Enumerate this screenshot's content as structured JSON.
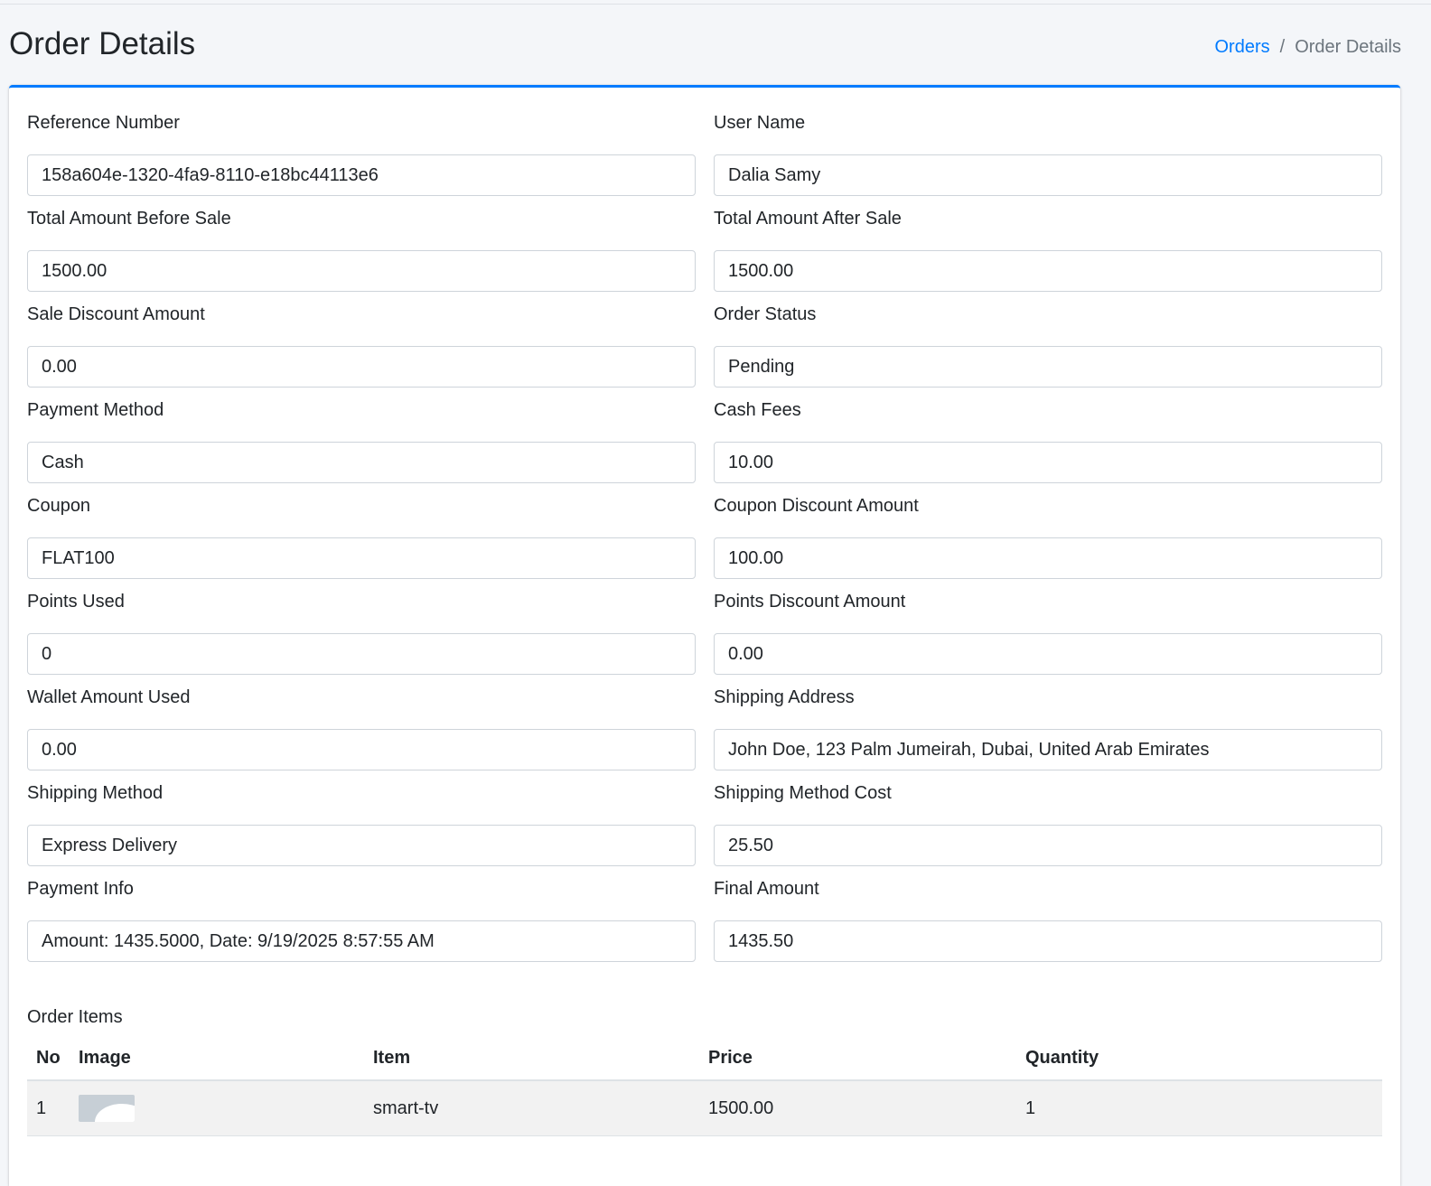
{
  "page": {
    "title": "Order Details"
  },
  "breadcrumb": {
    "parent": "Orders",
    "separator": "/",
    "current": "Order Details"
  },
  "fields": {
    "reference_number": {
      "label": "Reference Number",
      "value": "158a604e-1320-4fa9-8110-e18bc44113e6"
    },
    "user_name": {
      "label": "User Name",
      "value": "Dalia Samy"
    },
    "total_before_sale": {
      "label": "Total Amount Before Sale",
      "value": "1500.00"
    },
    "total_after_sale": {
      "label": "Total Amount After Sale",
      "value": "1500.00"
    },
    "sale_discount": {
      "label": "Sale Discount Amount",
      "value": "0.00"
    },
    "order_status": {
      "label": "Order Status",
      "value": "Pending"
    },
    "payment_method": {
      "label": "Payment Method",
      "value": "Cash"
    },
    "cash_fees": {
      "label": "Cash Fees",
      "value": "10.00"
    },
    "coupon": {
      "label": "Coupon",
      "value": "FLAT100"
    },
    "coupon_discount": {
      "label": "Coupon Discount Amount",
      "value": "100.00"
    },
    "points_used": {
      "label": "Points Used",
      "value": "0"
    },
    "points_discount": {
      "label": "Points Discount Amount",
      "value": "0.00"
    },
    "wallet_used": {
      "label": "Wallet Amount Used",
      "value": "0.00"
    },
    "shipping_address": {
      "label": "Shipping Address",
      "value": "John Doe, 123 Palm Jumeirah, Dubai, United Arab Emirates"
    },
    "shipping_method": {
      "label": "Shipping Method",
      "value": "Express Delivery"
    },
    "shipping_cost": {
      "label": "Shipping Method Cost",
      "value": "25.50"
    },
    "payment_info": {
      "label": "Payment Info",
      "value": "Amount: 1435.5000, Date: 9/19/2025 8:57:55 AM"
    },
    "final_amount": {
      "label": "Final Amount",
      "value": "1435.50"
    }
  },
  "order_items": {
    "title": "Order Items",
    "columns": [
      "No",
      "Image",
      "Item",
      "Price",
      "Quantity"
    ],
    "rows": [
      {
        "no": "1",
        "image": "image-placeholder-icon",
        "item": "smart-tv",
        "price": "1500.00",
        "quantity": "1"
      }
    ]
  },
  "colors": {
    "accent": "#007bff",
    "background": "#f4f6f9",
    "card": "#ffffff",
    "row_stripe": "#f2f2f2"
  }
}
